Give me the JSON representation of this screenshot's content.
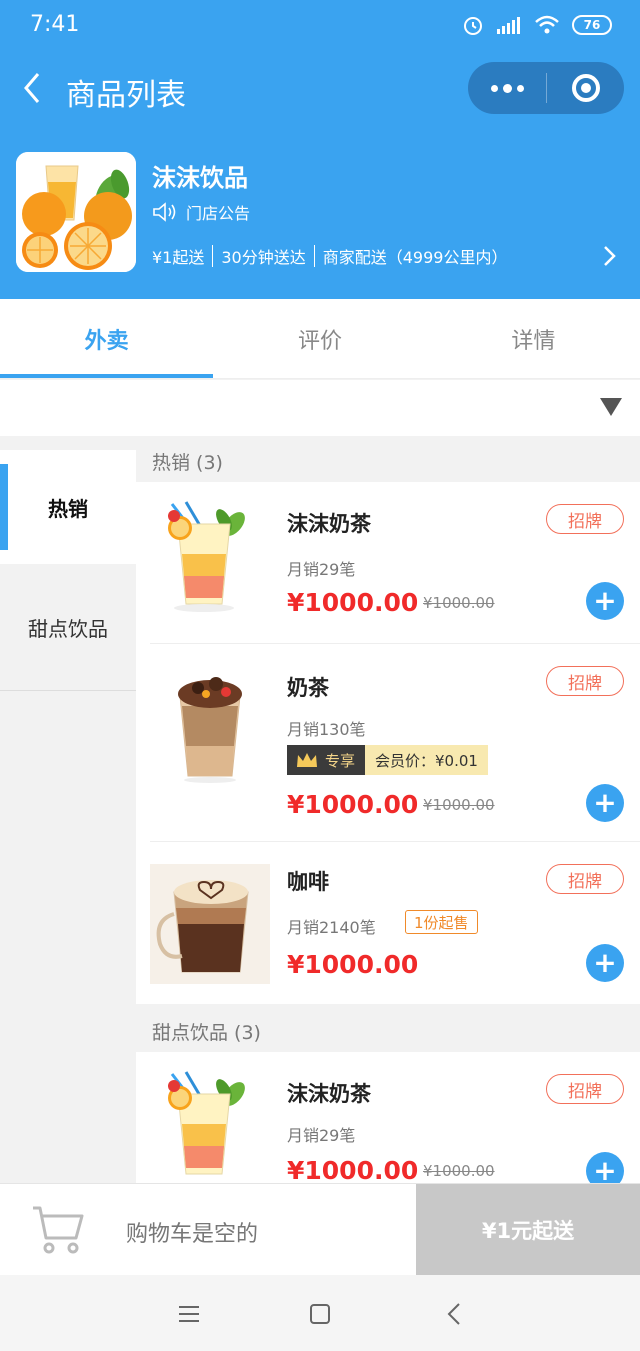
{
  "status_bar": {
    "time": "7:41",
    "battery": "76"
  },
  "header": {
    "title": "商品列表",
    "shop_name": "沫沫饮品",
    "notice": "门店公告",
    "meta": [
      "¥1起送",
      "30分钟送达",
      "商家配送（4999公里内）"
    ]
  },
  "tabs": [
    {
      "label": "外卖",
      "active": true
    },
    {
      "label": "评价",
      "active": false
    },
    {
      "label": "详情",
      "active": false
    }
  ],
  "sidebar": {
    "categories": [
      {
        "label": "热销",
        "active": true
      },
      {
        "label": "甜点饮品",
        "active": false
      }
    ]
  },
  "sections": [
    {
      "title": "热销 (3)",
      "items": [
        {
          "name": "沫沫奶茶",
          "badge": "招牌",
          "sales": "月销29笔",
          "price": "¥1000.00",
          "original_price": "¥1000.00",
          "image": "tropical-drink"
        },
        {
          "name": "奶茶",
          "badge": "招牌",
          "sales": "月销130笔",
          "vip_label": "专享",
          "vip_price": "会员价：¥0.01",
          "price": "¥1000.00",
          "original_price": "¥1000.00",
          "image": "milk-tea"
        },
        {
          "name": "咖啡",
          "badge": "招牌",
          "sales": "月销2140笔",
          "min_purchase": "1份起售",
          "price": "¥1000.00",
          "image": "coffee"
        }
      ]
    },
    {
      "title": "甜点饮品 (3)",
      "items": [
        {
          "name": "沫沫奶茶",
          "badge": "招牌",
          "sales": "月销29笔",
          "price": "¥1000.00",
          "original_price": "¥1000.00",
          "image": "tropical-drink"
        }
      ]
    }
  ],
  "cart": {
    "empty_text": "购物车是空的",
    "checkout_label": "¥1元起送"
  },
  "colors": {
    "primary": "#3aa3f0",
    "price": "#f02a2a",
    "badge": "#f2705a",
    "checkout_disabled": "#c8c8c8"
  }
}
